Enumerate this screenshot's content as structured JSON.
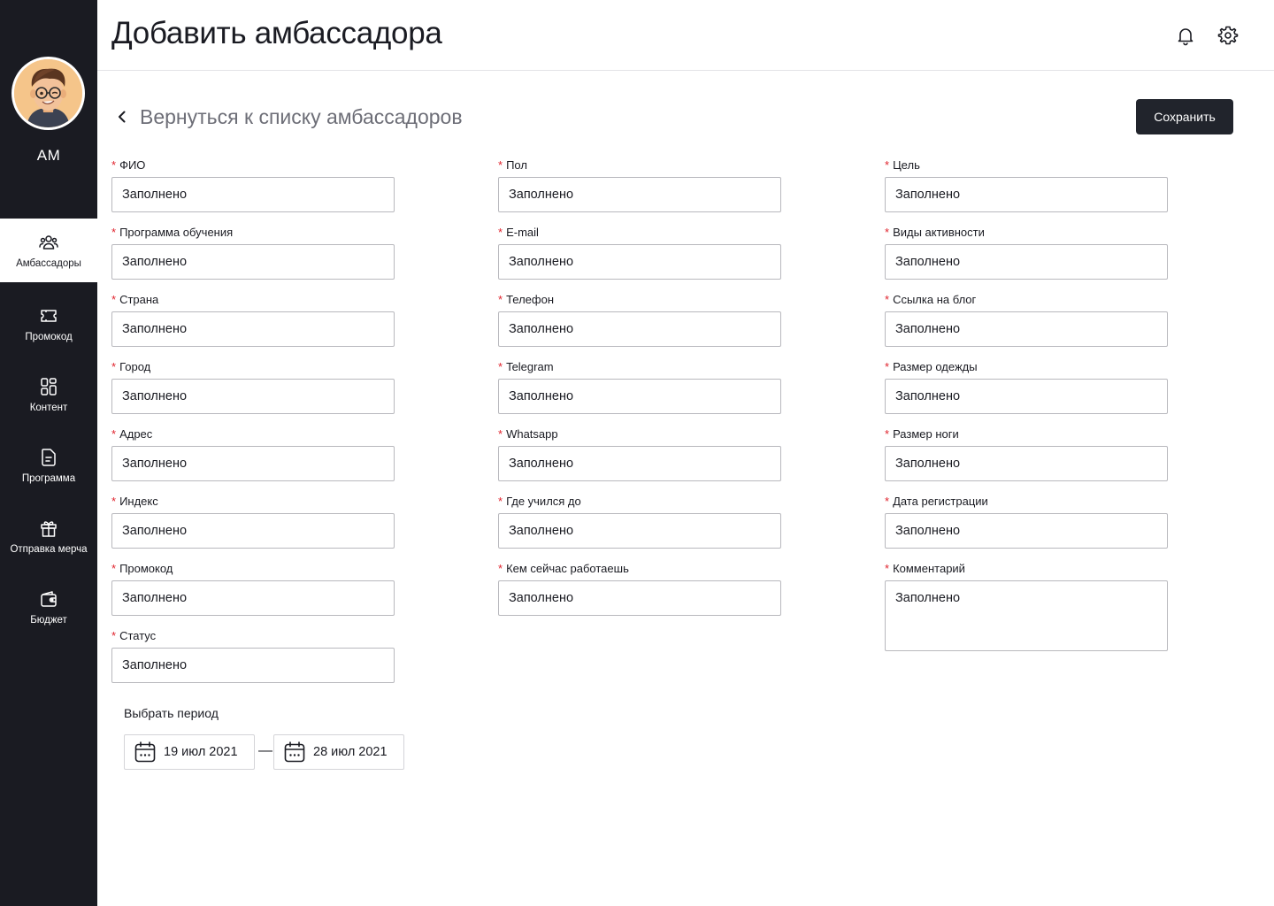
{
  "header": {
    "title": "Добавить амбассадора"
  },
  "user": {
    "initials": "АМ"
  },
  "sidebar": {
    "items": [
      {
        "label": "Амбассадоры",
        "icon": "users-icon",
        "active": true
      },
      {
        "label": "Промокод",
        "icon": "ticket-icon",
        "active": false
      },
      {
        "label": "Контент",
        "icon": "layout-icon",
        "active": false
      },
      {
        "label": "Программа",
        "icon": "document-icon",
        "active": false
      },
      {
        "label": "Отправка мерча",
        "icon": "gift-icon",
        "active": false
      },
      {
        "label": "Бюджет",
        "icon": "wallet-icon",
        "active": false
      }
    ]
  },
  "toolbar": {
    "back_label": "Вернуться к списку амбассадоров",
    "save_label": "Сохранить"
  },
  "form": {
    "required_mark": "*",
    "col1": [
      {
        "label": "ФИО",
        "value": "Заполнено"
      },
      {
        "label": "Программа обучения",
        "value": "Заполнено"
      },
      {
        "label": "Страна",
        "value": "Заполнено"
      },
      {
        "label": "Город",
        "value": "Заполнено"
      },
      {
        "label": "Адрес",
        "value": "Заполнено"
      },
      {
        "label": "Индекс",
        "value": "Заполнено"
      },
      {
        "label": "Промокод",
        "value": "Заполнено"
      },
      {
        "label": "Статус",
        "value": "Заполнено"
      }
    ],
    "col2": [
      {
        "label": "Пол",
        "value": "Заполнено"
      },
      {
        "label": "E-mail",
        "value": "Заполнено"
      },
      {
        "label": "Телефон",
        "value": "Заполнено"
      },
      {
        "label": "Telegram",
        "value": "Заполнено"
      },
      {
        "label": "Whatsapp",
        "value": "Заполнено"
      },
      {
        "label": "Где учился до",
        "value": "Заполнено"
      },
      {
        "label": "Кем сейчас работаешь",
        "value": "Заполнено"
      }
    ],
    "col3": [
      {
        "label": "Цель",
        "value": "Заполнено"
      },
      {
        "label": "Виды активности",
        "value": "Заполнено"
      },
      {
        "label": "Ссылка на блог",
        "value": "Заполнено"
      },
      {
        "label": "Размер одежды",
        "value": "Заполнено"
      },
      {
        "label": "Размер ноги",
        "value": "Заполнено"
      },
      {
        "label": "Дата регистрации",
        "value": "Заполнено"
      },
      {
        "label": "Комментарий",
        "value": "Заполнено"
      }
    ]
  },
  "period": {
    "label": "Выбрать период",
    "start": "19 июл 2021",
    "separator": "—",
    "end": "28 июл 2021"
  },
  "colors": {
    "sidebar_bg": "#1a1b22",
    "accent_button": "#21242c",
    "required": "#e0232d",
    "avatar_bg": "#f5c58a"
  }
}
